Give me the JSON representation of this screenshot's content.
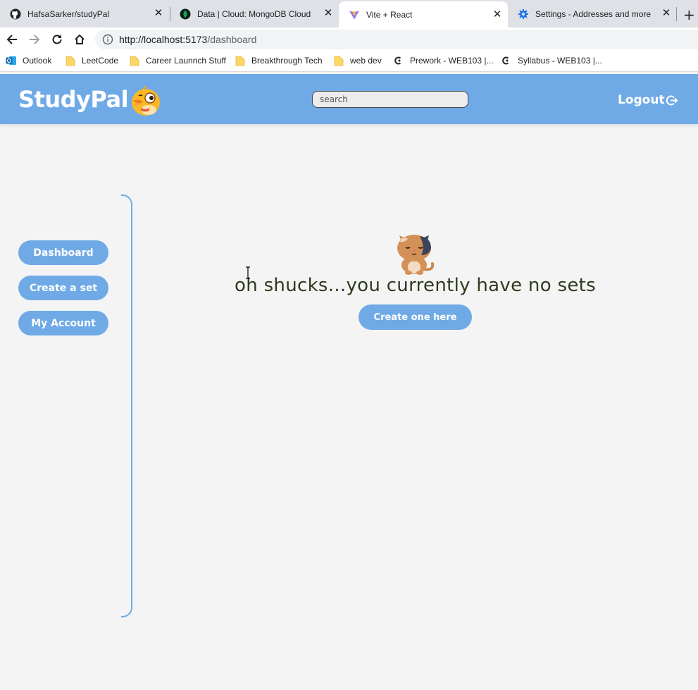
{
  "browser": {
    "tabs": [
      {
        "title": "HafsaSarker/studyPal",
        "icon": "github-icon",
        "active": false
      },
      {
        "title": "Data | Cloud: MongoDB Cloud",
        "icon": "mongodb-icon",
        "active": false
      },
      {
        "title": "Vite + React",
        "icon": "vite-icon",
        "active": true
      },
      {
        "title": "Settings - Addresses and more",
        "icon": "gear-icon",
        "active": false
      }
    ],
    "url_host": "http://localhost:5173",
    "url_path": "/dashboard",
    "bookmarks": [
      {
        "label": "Outlook",
        "icon": "outlook-icon"
      },
      {
        "label": "LeetCode",
        "icon": "folder-icon"
      },
      {
        "label": "Career Launnch Stuff",
        "icon": "folder-icon"
      },
      {
        "label": "Breakthrough Tech",
        "icon": "folder-icon"
      },
      {
        "label": "web dev",
        "icon": "folder-icon"
      },
      {
        "label": "Prework - WEB103 |...",
        "icon": "codepath-icon"
      },
      {
        "label": "Syllabus - WEB103 |...",
        "icon": "codepath-icon"
      }
    ]
  },
  "header": {
    "logo": "StudyPal",
    "search_placeholder": "search",
    "logout_label": "Logout"
  },
  "sidebar": {
    "items": [
      {
        "label": "Dashboard"
      },
      {
        "label": "Create a set"
      },
      {
        "label": "My Account"
      }
    ]
  },
  "main": {
    "empty_message": "oh shucks...you currently have no sets",
    "create_button": "Create one here"
  },
  "colors": {
    "accent": "#6faae6",
    "background": "#f4f4f4",
    "message_text": "#2f3a1f"
  }
}
